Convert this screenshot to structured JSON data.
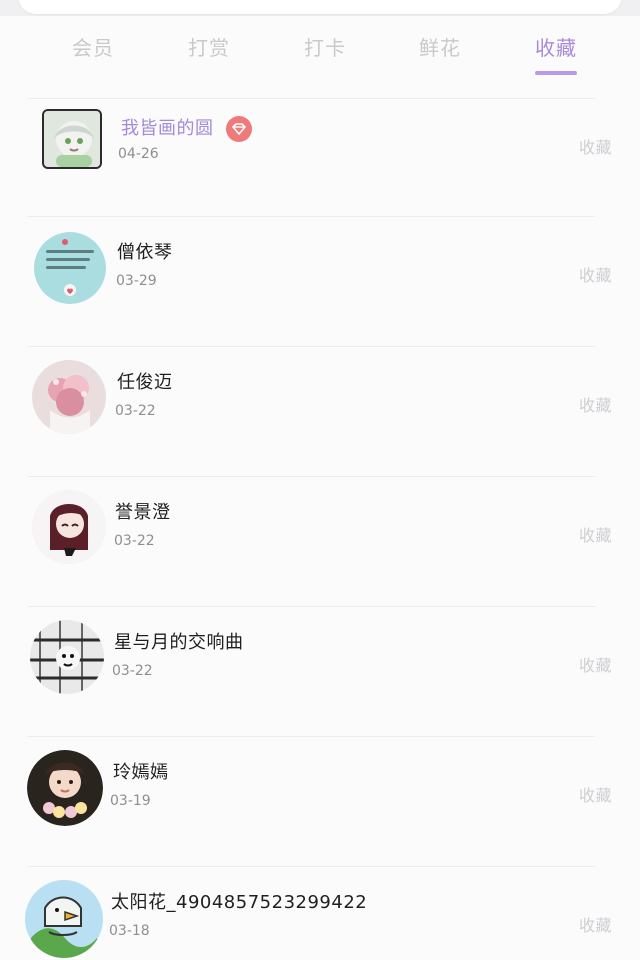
{
  "tabs": [
    {
      "label": "会员",
      "active": false
    },
    {
      "label": "打赏",
      "active": false
    },
    {
      "label": "打卡",
      "active": false
    },
    {
      "label": "鲜花",
      "active": false
    },
    {
      "label": "收藏",
      "active": true
    }
  ],
  "list": {
    "items": [
      {
        "name": "我皆画的圆",
        "date": "04-26",
        "action": "收藏",
        "vip": true
      },
      {
        "name": "僧依琴",
        "date": "03-29",
        "action": "收藏",
        "vip": false
      },
      {
        "name": "任俊迈",
        "date": "03-22",
        "action": "收藏",
        "vip": false
      },
      {
        "name": "誉景澄",
        "date": "03-22",
        "action": "收藏",
        "vip": false
      },
      {
        "name": "星与月的交响曲",
        "date": "03-22",
        "action": "收藏",
        "vip": false
      },
      {
        "name": "玲嫣嫣",
        "date": "03-19",
        "action": "收藏",
        "vip": false
      },
      {
        "name": "太阳花_4904857523299422",
        "date": "03-18",
        "action": "收藏",
        "vip": false
      }
    ]
  },
  "colors": {
    "accent": "#a98ad9",
    "inactive_tab": "#c9c9cc",
    "vip_name": "#a48ad8",
    "badge": "#ee7b79"
  },
  "icons": {
    "badge": "diamond-icon"
  }
}
